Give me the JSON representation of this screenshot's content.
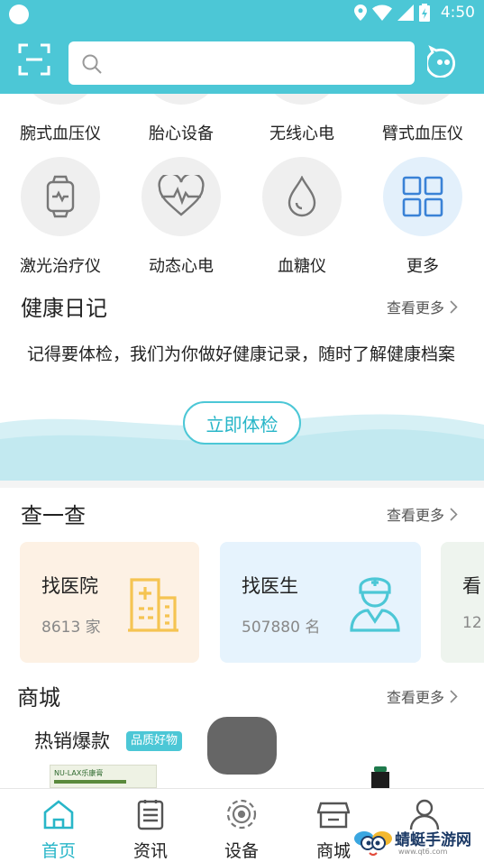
{
  "status_bar": {
    "time": "4:50",
    "icons": [
      "location-icon",
      "wifi-icon",
      "signal-icon",
      "battery-icon"
    ]
  },
  "header": {
    "search": {
      "placeholder": ""
    },
    "icons": [
      "scan-icon",
      "search-icon",
      "message-icon"
    ]
  },
  "devices": {
    "row1": [
      "腕式血压仪",
      "胎心设备",
      "无线心电",
      "臂式血压仪"
    ],
    "row2": [
      {
        "label": "激光治疗仪",
        "icon": "smartwatch-icon"
      },
      {
        "label": "动态心电",
        "icon": "heart-ecg-icon"
      },
      {
        "label": "血糖仪",
        "icon": "blood-drop-icon"
      },
      {
        "label": "更多",
        "icon": "grid-icon"
      }
    ]
  },
  "health_diary": {
    "title": "健康日记",
    "see_more": "查看更多",
    "text": "记得要体检，我们为你做好健康记录，随时了解健康档案",
    "button": "立即体检"
  },
  "lookup": {
    "title": "查一查",
    "see_more": "查看更多",
    "cards": [
      {
        "title": "找医院",
        "count": "8613",
        "unit": "家",
        "icon": "hospital-icon",
        "bg": "#fdf1e4",
        "accent": "#f5c452"
      },
      {
        "title": "找医生",
        "count": "507880",
        "unit": "名",
        "icon": "doctor-icon",
        "bg": "#e6f3fd",
        "accent": "#4cc7d6"
      },
      {
        "title": "看",
        "count": "12",
        "unit": "",
        "icon": "",
        "bg": "#eef4ee",
        "accent": "#7fb08a"
      }
    ]
  },
  "shop": {
    "title": "商城",
    "see_more": "查看更多",
    "hot_title": "热销爆款",
    "badge": "品质好物",
    "product_label": "NU-LAX乐康膏"
  },
  "bottom_nav": [
    {
      "label": "首页",
      "icon": "home-icon",
      "active": true
    },
    {
      "label": "资讯",
      "icon": "news-icon",
      "active": false
    },
    {
      "label": "设备",
      "icon": "device-icon",
      "active": false
    },
    {
      "label": "商城",
      "icon": "store-icon",
      "active": false
    },
    {
      "label": "",
      "icon": "profile-icon",
      "active": false
    }
  ],
  "watermark": {
    "text": "蜻蜓手游网",
    "sub": "www.qt6.com"
  },
  "colors": {
    "primary": "#4cc7d6",
    "primary_text": "#28b6c8"
  }
}
